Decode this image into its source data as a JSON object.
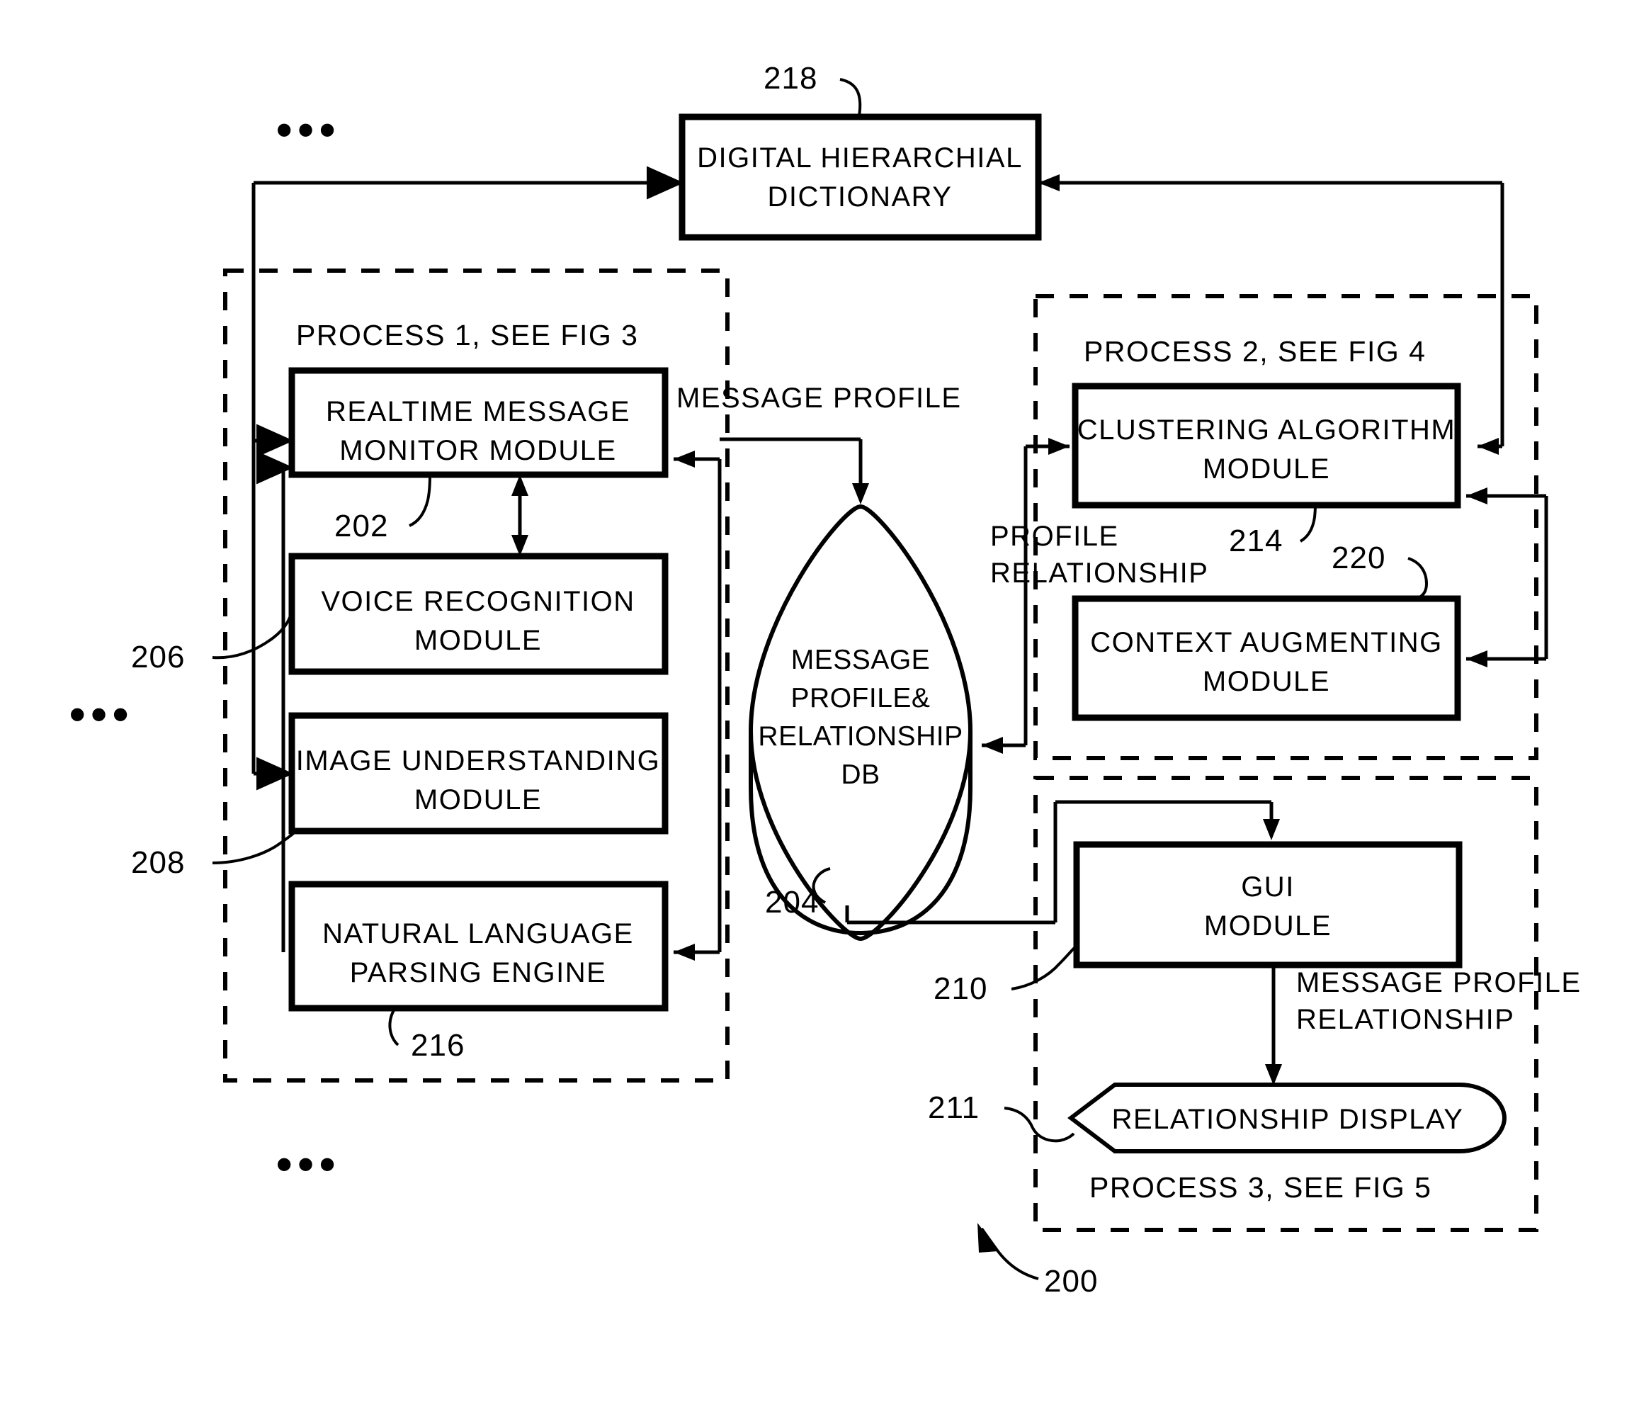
{
  "figure": {
    "overall_ref": "200",
    "ellipsis": "•••"
  },
  "dictionary": {
    "line1": "DIGITAL  HIERARCHIAL",
    "line2": "DICTIONARY",
    "ref": "218"
  },
  "process1": {
    "title": "PROCESS 1, SEE FIG 3",
    "modules": [
      {
        "line1": "REALTIME  MESSAGE",
        "line2": "MONITOR  MODULE",
        "ref": "202"
      },
      {
        "line1": "VOICE  RECOGNITION",
        "line2": "MODULE",
        "ref": "206"
      },
      {
        "line1": "IMAGE  UNDERSTANDING",
        "line2": "MODULE",
        "ref": "208"
      },
      {
        "line1": "NATURAL  LANGUAGE",
        "line2": "PARSING  ENGINE",
        "ref": "216"
      }
    ]
  },
  "process2": {
    "title": "PROCESS 2, SEE FIG 4",
    "modules": [
      {
        "line1": "CLUSTERING  ALGORITHM",
        "line2": "MODULE",
        "ref": "214"
      },
      {
        "line1": "CONTEXT  AUGMENTING",
        "line2": "MODULE",
        "ref": "220"
      }
    ]
  },
  "process3": {
    "title": "PROCESS 3, SEE FIG 5",
    "gui": {
      "line1": "GUI",
      "line2": "MODULE",
      "ref": "210"
    },
    "display": {
      "label": "RELATIONSHIP  DISPLAY",
      "ref": "211"
    }
  },
  "database": {
    "line1": "MESSAGE",
    "line2": "PROFILE&",
    "line3": "RELATIONSHIP",
    "line4": "DB",
    "ref": "204"
  },
  "edge_labels": {
    "message_profile": "MESSAGE PROFILE",
    "profile_relationship_l1": "PROFILE",
    "profile_relationship_l2": "RELATIONSHIP",
    "message_profile_rel_l1": "MESSAGE  PROFILE",
    "message_profile_rel_l2": "RELATIONSHIP"
  },
  "colors": {
    "stroke": "#000000",
    "background": "#ffffff"
  }
}
